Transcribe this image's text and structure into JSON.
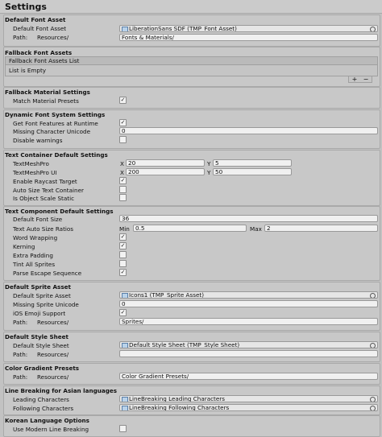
{
  "title": "Settings",
  "default_font_asset": {
    "header": "Default Font Asset",
    "asset_label": "Default Font Asset",
    "asset_value": "LiberationSans SDF (TMP_Font Asset)",
    "path_label": "Path:",
    "path_prefix": "Resources/",
    "path_value": "Fonts & Materials/"
  },
  "fallback_font_assets": {
    "header": "Fallback Font Assets",
    "list_title": "Fallback Font Assets List",
    "list_empty": "List is Empty",
    "add_symbol": "+",
    "remove_symbol": "−"
  },
  "fallback_material": {
    "header": "Fallback Material Settings",
    "match_label": "Match Material Presets",
    "match_check": "✓"
  },
  "dynamic_font": {
    "header": "Dynamic Font System Settings",
    "get_features_label": "Get Font Features at Runtime",
    "get_features_check": "✓",
    "missing_char_label": "Missing Character Unicode",
    "missing_char_value": "0",
    "disable_warnings_label": "Disable warnings",
    "disable_warnings_check": ""
  },
  "text_container": {
    "header": "Text Container Default Settings",
    "tmp_label": "TextMeshPro",
    "tmp_x": "20",
    "tmp_y": "5",
    "tmpui_label": "TextMeshPro UI",
    "tmpui_x": "200",
    "tmpui_y": "50",
    "x_axis": "X",
    "y_axis": "Y",
    "raycast_label": "Enable Raycast Target",
    "raycast_check": "✓",
    "autosize_label": "Auto Size Text Container",
    "autosize_check": "",
    "objscale_label": "Is Object Scale Static",
    "objscale_check": ""
  },
  "text_component": {
    "header": "Text Component Default Settings",
    "font_size_label": "Default Font Size",
    "font_size_value": "36",
    "ratios_label": "Text Auto Size Ratios",
    "min_label": "Min",
    "min_value": "0.5",
    "max_label": "Max",
    "max_value": "2",
    "word_wrap_label": "Word Wrapping",
    "word_wrap_check": "✓",
    "kerning_label": "Kerning",
    "kerning_check": "✓",
    "extra_padding_label": "Extra Padding",
    "extra_padding_check": "",
    "tint_label": "Tint All Sprites",
    "tint_check": "",
    "escape_label": "Parse Escape Sequence",
    "escape_check": "✓"
  },
  "default_sprite": {
    "header": "Default Sprite Asset",
    "asset_label": "Default Sprite Asset",
    "asset_value": "Icons1 (TMP_Sprite Asset)",
    "missing_label": "Missing Sprite Unicode",
    "missing_value": "0",
    "emoji_label": "iOS Emoji Support",
    "emoji_check": "✓",
    "path_label": "Path:",
    "path_prefix": "Resources/",
    "path_value": "Sprites/"
  },
  "default_style": {
    "header": "Default Style Sheet",
    "asset_label": "Default Style Sheet",
    "asset_value": "Default Style Sheet (TMP_Style Sheet)",
    "path_label": "Path:",
    "path_prefix": "Resources/",
    "path_value": ""
  },
  "color_gradient": {
    "header": "Color Gradient Presets",
    "path_label": "Path:",
    "path_prefix": "Resources/",
    "path_value": "Color Gradient Presets/"
  },
  "line_breaking": {
    "header": "Line Breaking for Asian languages",
    "leading_label": "Leading Characters",
    "leading_value": "LineBreaking Leading Characters",
    "following_label": "Following Characters",
    "following_value": "LineBreaking Following Characters"
  },
  "korean": {
    "header": "Korean Language Options",
    "modern_label": "Use Modern Line Breaking",
    "modern_check": ""
  }
}
